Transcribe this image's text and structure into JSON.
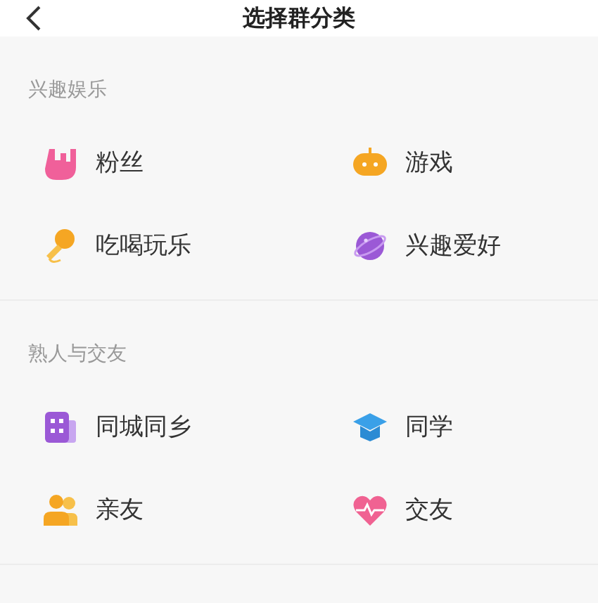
{
  "header": {
    "title": "选择群分类"
  },
  "sections": [
    {
      "title": "兴趣娱乐",
      "items": [
        {
          "label": "粉丝"
        },
        {
          "label": "游戏"
        },
        {
          "label": "吃喝玩乐"
        },
        {
          "label": "兴趣爱好"
        }
      ]
    },
    {
      "title": "熟人与交友",
      "items": [
        {
          "label": "同城同乡"
        },
        {
          "label": "同学"
        },
        {
          "label": "亲友"
        },
        {
          "label": "交友"
        }
      ]
    }
  ]
}
